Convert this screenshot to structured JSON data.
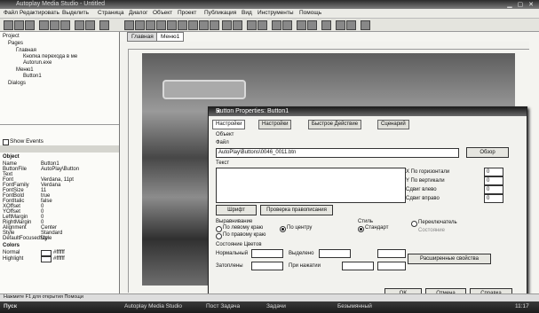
{
  "app": {
    "title": "Autoplay Media Studio - Untitled"
  },
  "menu": [
    "Файл",
    "Редактировать",
    "Выделить",
    "Страница",
    "Диалог",
    "Объект",
    "Проект",
    "Публикация",
    "Вид",
    "Инструменты",
    "Помощь"
  ],
  "page_tabs": [
    "Главная",
    "Меню1"
  ],
  "project_tree": {
    "items": [
      "Project",
      "Pages",
      "Главная",
      "Кнопка перехода в ме",
      "Autorun.exe",
      "Меню1",
      "Button1",
      "Dialogs"
    ]
  },
  "show_events": "Show Events",
  "properties": {
    "header": "Object",
    "rows": [
      {
        "k": "Name",
        "v": "Button1"
      },
      {
        "k": "ButtonFile",
        "v": "AutoPlay\\Button"
      },
      {
        "k": "Text",
        "v": ""
      },
      {
        "k": "Font",
        "v": "Verdana, 11pt"
      },
      {
        "k": "FontFamily",
        "v": "Verdana"
      },
      {
        "k": "FontSize",
        "v": "11"
      },
      {
        "k": "FontBold",
        "v": "true"
      },
      {
        "k": "FontItalic",
        "v": "false"
      },
      {
        "k": "XOffset",
        "v": "0"
      },
      {
        "k": "YOffset",
        "v": "0"
      },
      {
        "k": "LeftMargin",
        "v": "0"
      },
      {
        "k": "RightMargin",
        "v": "0"
      },
      {
        "k": "Alignment",
        "v": "Center"
      },
      {
        "k": "Style",
        "v": "Standard"
      },
      {
        "k": "DefaultFocusedStyle",
        "v": "Up"
      }
    ],
    "colors_header": "Colors",
    "color_rows": [
      {
        "k": "Normal",
        "v": "#ffffff"
      },
      {
        "k": "Highlight",
        "v": "#ffffff"
      }
    ]
  },
  "dialog": {
    "title": "Button Properties: Button1",
    "tabs": [
      "Настройки",
      "Настройки",
      "Быстрое Действие",
      "Сценарий"
    ],
    "section_object": "Объект",
    "file_label": "Файл",
    "file_value": "AutoPlay\\Buttons\\0046_0011.btn",
    "browse": "Обзор",
    "text_label": "Текст",
    "font_button": "Шрифт",
    "cursor_button": "Проверка правописания",
    "h_label": "Х По горизонтали",
    "v_label": "Y По вертикали",
    "shift_label": "Сдвиг влево",
    "shift2_label": "Сдвиг вправо",
    "hval": "0",
    "vval": "0",
    "sval": "0",
    "s2val": "0",
    "alignment_label": "Выравнивание",
    "align_left": "По левому краю",
    "align_center": "По центру",
    "align_right": "По правому краю",
    "style_label": "Стиль",
    "style_standard": "Стандарт",
    "style_toggle": "Переключатель",
    "state_label": "Состояние",
    "colors_label": "Состояние Цветов",
    "normal": "Нормальный",
    "highlight": "Выделено",
    "pressed": "Затоплены",
    "disabled": "При нажатии",
    "advanced_button": "Расширенные свойства",
    "ok": "OK",
    "cancel": "Отмена",
    "help": "Справка"
  },
  "status": "Нажмите F1 для открытия Помощи",
  "taskbar": [
    "Пуск",
    "Autoplay Media Studio",
    "Пост Задача",
    "Задачи",
    "Безымянный"
  ],
  "clock": "11:17"
}
